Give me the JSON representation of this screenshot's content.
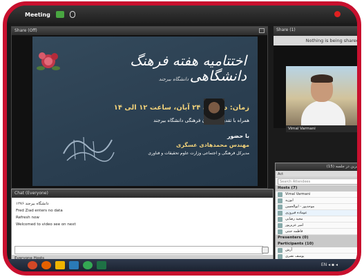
{
  "app": {
    "menu_label": "Meeting",
    "window_title": "",
    "colors": {
      "frame": "#c8102e",
      "accent_gold": "#f2d27a",
      "slide_bg": "#2a3e50"
    }
  },
  "share_pod": {
    "title": "Share (Off)",
    "slide": {
      "title": "اختتامیه هفته فرهنگ دانشگاهی",
      "subtitle": "دانشگاه بیرجند",
      "time": "زمان: دوشنبه ۲۴ آبان، ساعت ۱۲ الی ۱۴",
      "note": "همراه با تقدیر از فعالان فرهنگی دانشگاه بیرجند",
      "with": "با حضور",
      "speaker": "مهندس محمدهادی عسگری",
      "role": "مدیرکل فرهنگی و اجتماعی وزارت علوم تحقیقات و فناوری"
    }
  },
  "camera_pod": {
    "title": "Share (1)",
    "status": "Nothing is being shared.",
    "video_name": "Vimal Varmani"
  },
  "attendees_pod": {
    "title": "حاضرین در جلسه (15)",
    "toolbar": "Act",
    "search_placeholder": "Search Attendees",
    "groups": [
      {
        "label": "Hosts (7)",
        "rows": [
          {
            "name": "Vimal Varmani",
            "mic": true
          },
          {
            "name": "ابوزید",
            "mic": false
          },
          {
            "name": "موحدپور - ابوالحسن",
            "mic": false
          },
          {
            "name": "عوماده فیروزی",
            "mic": true
          },
          {
            "name": "مجید رضایی",
            "mic": false
          },
          {
            "name": "امیر عزیزپور",
            "mic": false
          },
          {
            "name": "فاطمه جنتی",
            "mic": false
          }
        ]
      },
      {
        "label": "Presenters (0)",
        "rows": []
      },
      {
        "label": "Participants (10)",
        "rows": [
          {
            "name": "آرش",
            "mic": false
          },
          {
            "name": "یوسف نصری",
            "mic": false
          }
        ]
      }
    ]
  },
  "chat_pod": {
    "title": "Chat (Everyone)",
    "lines": [
      "۱۲۷۶ دانشگاه بیرجند",
      "Fred Ziad enters no data",
      "Refresh now",
      "Welcomed to video see on next"
    ],
    "tabs": "Everyone  Hosts"
  },
  "taskbar": {
    "apps": [
      {
        "icon": "start-icon",
        "color": "#d24726"
      },
      {
        "icon": "firefox-icon",
        "color": "#e66000"
      },
      {
        "icon": "file-explorer-icon",
        "color": "#f0b400"
      },
      {
        "icon": "media-player-icon",
        "color": "#2a7ab8"
      },
      {
        "icon": "chrome-icon",
        "color": "#34a853"
      },
      {
        "icon": "excel-icon",
        "color": "#1e7145"
      }
    ],
    "tray_text": "EN  ◂ ▪ ◂"
  }
}
